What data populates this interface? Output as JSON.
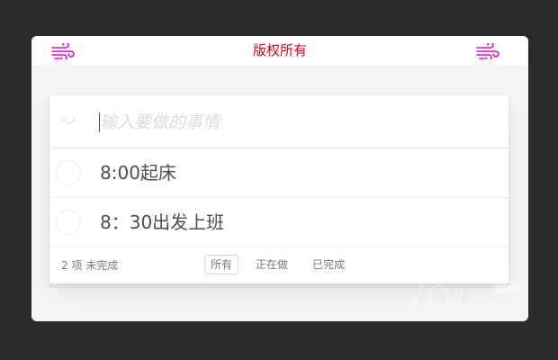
{
  "header": {
    "title": "版权所有",
    "left_icon": "wind-icon",
    "right_icon": "wind-icon",
    "title_color": "#e0001b",
    "icon_color": "#e20fc7"
  },
  "todo": {
    "input_placeholder": "输入要做的事情",
    "items": [
      {
        "label": "8:00起床",
        "completed": false
      },
      {
        "label": "8：30出发上班",
        "completed": false
      }
    ],
    "footer": {
      "count": "2 项 未完成",
      "filters": [
        "所有",
        "正在做",
        "已完成"
      ],
      "selected_filter": "所有"
    }
  }
}
